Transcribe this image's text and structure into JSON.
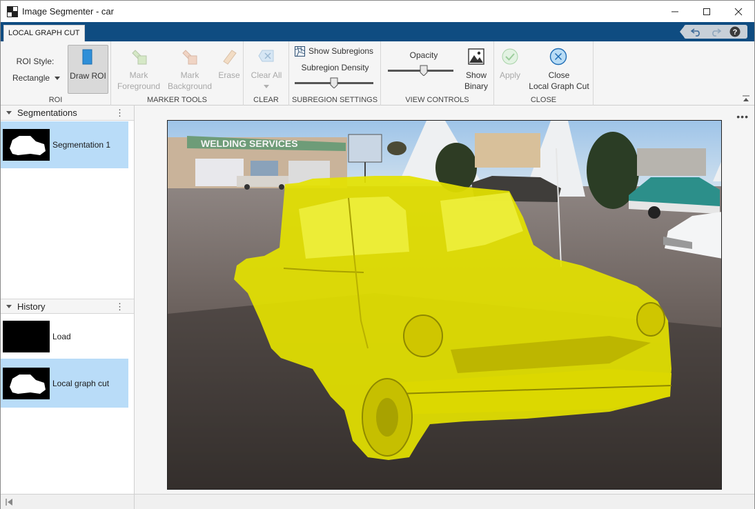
{
  "window": {
    "title": "Image Segmenter - car"
  },
  "toolstrip": {
    "tab_label": "LOCAL GRAPH CUT",
    "roi": {
      "style_label": "ROI Style:",
      "style_value": "Rectangle",
      "draw_roi_label": "Draw ROI",
      "section_label": "ROI"
    },
    "marker_tools": {
      "mark_foreground_line1": "Mark",
      "mark_foreground_line2": "Foreground",
      "mark_background_line1": "Mark",
      "mark_background_line2": "Background",
      "erase_label": "Erase",
      "section_label": "MARKER TOOLS"
    },
    "clear": {
      "clear_all_label": "Clear All",
      "section_label": "CLEAR"
    },
    "subregion_settings": {
      "show_subregions_label": "Show Subregions",
      "show_subregions_checked": false,
      "density_label": "Subregion Density",
      "density_value": 0.5,
      "section_label": "SUBREGION SETTINGS"
    },
    "view_controls": {
      "opacity_label": "Opacity",
      "opacity_value": 0.55,
      "show_binary_line1": "Show",
      "show_binary_line2": "Binary",
      "section_label": "VIEW CONTROLS"
    },
    "close": {
      "apply_label": "Apply",
      "close_line1": "Close",
      "close_line2": "Local Graph Cut",
      "section_label": "CLOSE"
    }
  },
  "segmentations": {
    "title": "Segmentations",
    "items": [
      {
        "label": "Segmentation 1"
      }
    ]
  },
  "history": {
    "title": "History",
    "items": [
      {
        "label": "Load"
      },
      {
        "label": "Local graph cut"
      }
    ]
  },
  "image": {
    "sign_text": "WELDING SERVICES",
    "overlay_color": "#e6e600"
  },
  "colors": {
    "accent": "#0f4c81",
    "selection": "#b9dcf8"
  }
}
